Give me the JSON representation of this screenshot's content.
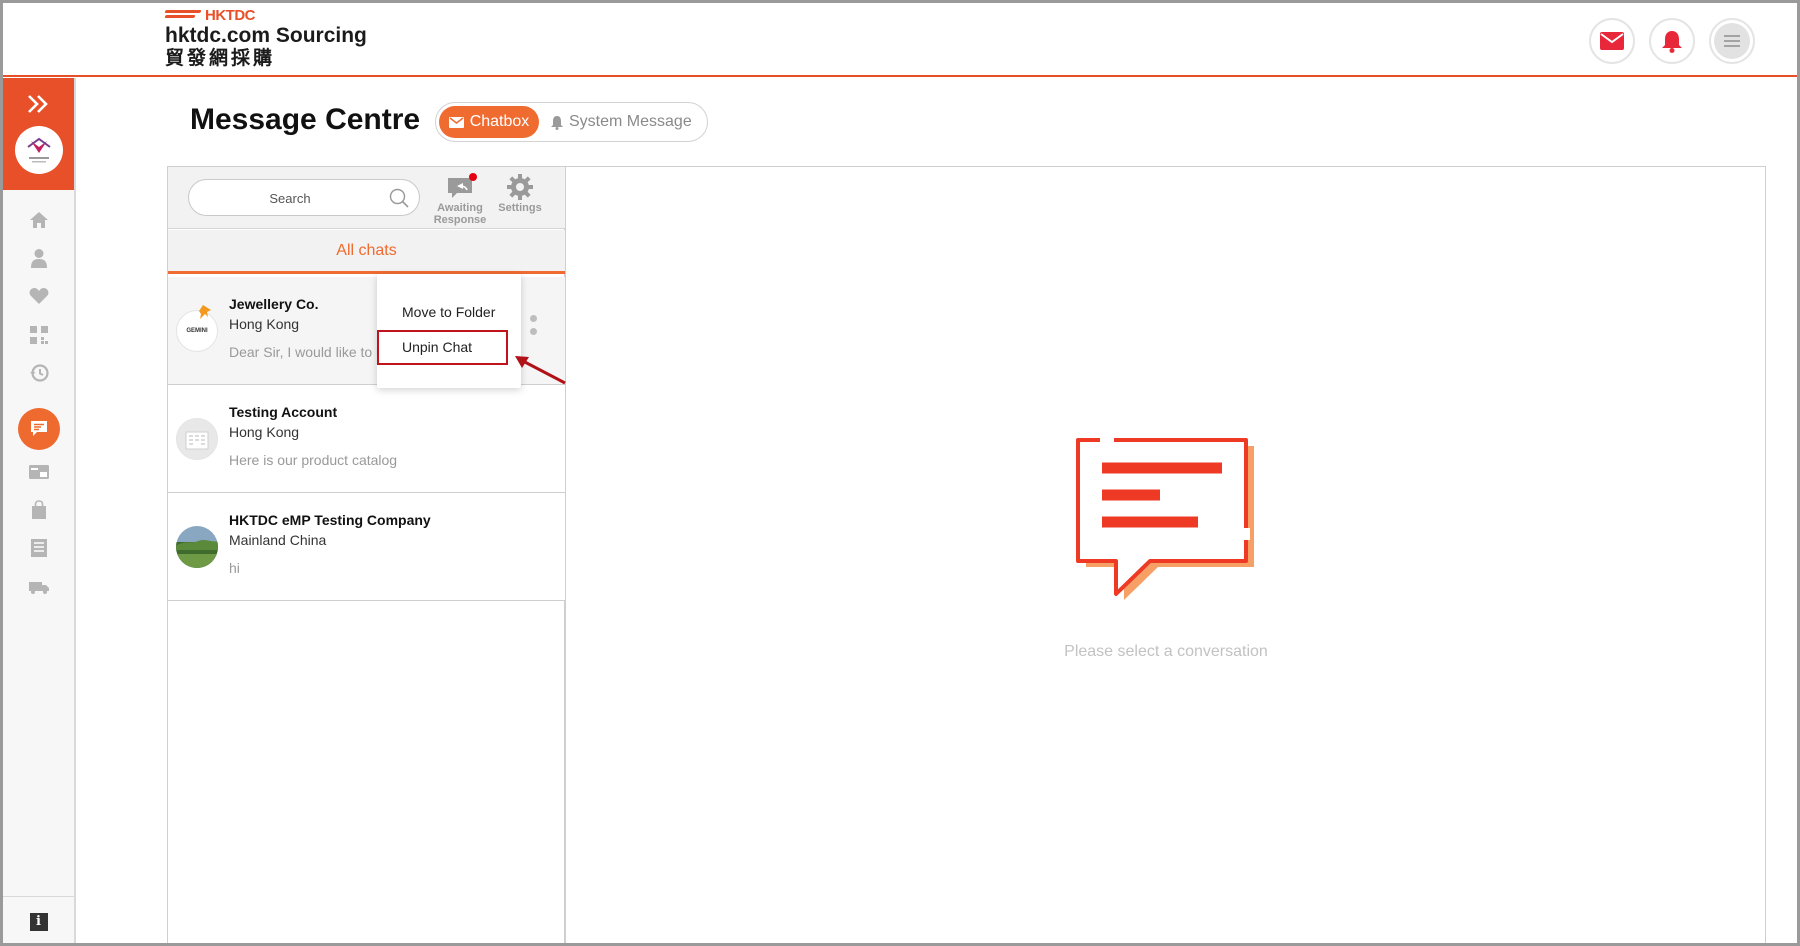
{
  "header": {
    "logo_brand": "HKTDC",
    "logo_title": "hktdc.com Sourcing",
    "logo_subtitle": "貿發網採購",
    "icons": [
      "mail-icon",
      "bell-icon",
      "menu-icon"
    ]
  },
  "sidebar": {
    "items": [
      "expand-icon",
      "home-icon",
      "user-icon",
      "heart-icon",
      "qr-icon",
      "history-icon",
      "chat-icon",
      "card-icon",
      "bag-icon",
      "list-icon",
      "truck-icon"
    ],
    "info_icon": "i"
  },
  "page": {
    "title": "Message Centre",
    "tabs": [
      {
        "label": "Chatbox",
        "active": true
      },
      {
        "label": "System Message",
        "active": false
      }
    ]
  },
  "chat_list": {
    "search_placeholder": "Search",
    "tools": [
      {
        "label_line1": "Awaiting",
        "label_line2": "Response"
      },
      {
        "label_line1": "Settings",
        "label_line2": ""
      }
    ],
    "filter_label": "All chats",
    "chats": [
      {
        "name": "Jewellery Co.",
        "location": "Hong Kong",
        "preview": "Dear Sir, I would like to k",
        "avatar_text": "GEMINI",
        "pinned": true
      },
      {
        "name": "Testing Account",
        "location": "Hong Kong",
        "preview": "Here is our product catalog",
        "pinned": false
      },
      {
        "name": "HKTDC eMP Testing Company",
        "location": "Mainland China",
        "preview": "hi",
        "pinned": false
      }
    ]
  },
  "context_menu": {
    "items": [
      "Move to Folder",
      "Unpin Chat"
    ],
    "highlighted": "Unpin Chat"
  },
  "conversation": {
    "empty_text": "Please select a conversation"
  },
  "colors": {
    "accent": "#ef6b30",
    "brand_red": "#e8502a",
    "highlight": "#c0131b"
  }
}
